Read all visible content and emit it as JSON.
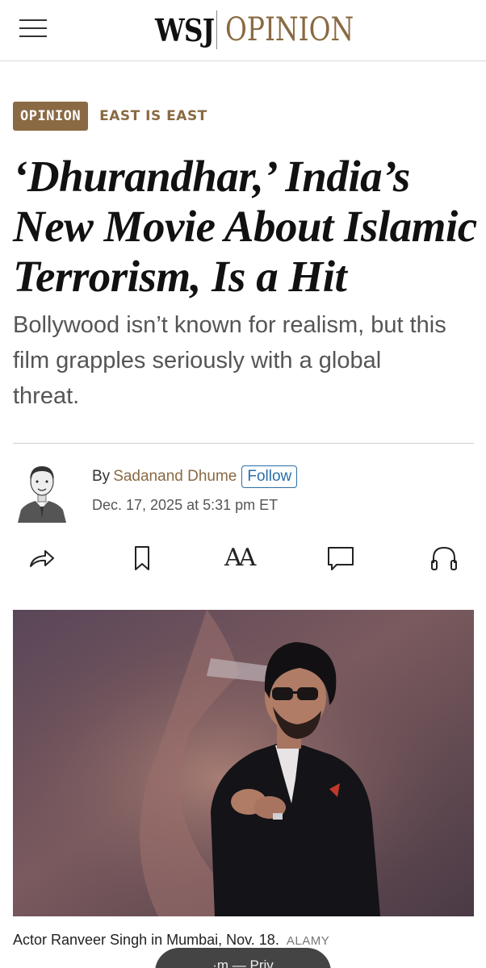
{
  "header": {
    "brand": "WSJ",
    "section": "OPINION"
  },
  "category": {
    "badge": "OPINION",
    "column": "EAST IS EAST"
  },
  "article": {
    "headline_lines": [
      "‘Dhurandhar,’ India’s",
      "New Movie About Islamic",
      "Terrorism, Is a Hit"
    ],
    "dek_lines": [
      "Bollywood isn’t known for realism, but this",
      "film grapples seriously with a global",
      "threat."
    ]
  },
  "byline": {
    "by": "By",
    "author": "Sadanand Dhume",
    "follow_label": "Follow",
    "date": "Dec. 17, 2025 at 5:31 pm ET"
  },
  "toolbar": {
    "icons": [
      "share-icon",
      "bookmark-icon",
      "text-size-icon",
      "comment-icon",
      "headphones-icon"
    ],
    "text_size_glyph": "AA"
  },
  "photo": {
    "caption": "Actor Ranveer Singh in Mumbai, Nov. 18.",
    "credit": "ALAMY"
  },
  "bottom_pill": {
    "text": "·m — Priv"
  },
  "colors": {
    "accent": "#8a6a43",
    "link": "#2a6eaa"
  }
}
